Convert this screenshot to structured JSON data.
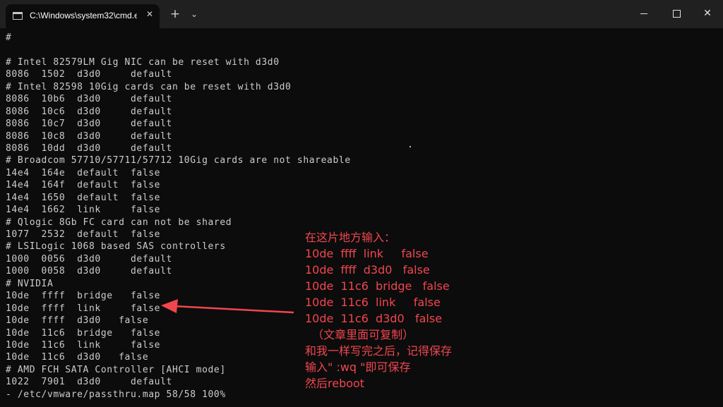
{
  "window": {
    "tab_title": "C:\\Windows\\system32\\cmd.e",
    "tab_close": "✕",
    "new_tab": "+",
    "dropdown": "⌄",
    "close_glyph": "✕"
  },
  "terminal": {
    "lines": [
      "#",
      "",
      "# Intel 82579LM Gig NIC can be reset with d3d0",
      "8086  1502  d3d0     default",
      "# Intel 82598 10Gig cards can be reset with d3d0",
      "8086  10b6  d3d0     default",
      "8086  10c6  d3d0     default",
      "8086  10c7  d3d0     default",
      "8086  10c8  d3d0     default",
      "8086  10dd  d3d0     default",
      "# Broadcom 57710/57711/57712 10Gig cards are not shareable",
      "14e4  164e  default  false",
      "14e4  164f  default  false",
      "14e4  1650  default  false",
      "14e4  1662  link     false",
      "# Qlogic 8Gb FC card can not be shared",
      "1077  2532  default  false",
      "# LSILogic 1068 based SAS controllers",
      "1000  0056  d3d0     default",
      "1000  0058  d3d0     default",
      "# NVIDIA",
      "10de  ffff  bridge   false",
      "10de  ffff  link     false",
      "10de  ffff  d3d0   false",
      "10de  11c6  bridge   false",
      "10de  11c6  link     false",
      "10de  11c6  d3d0   false",
      "# AMD FCH SATA Controller [AHCI mode]",
      "1022  7901  d3d0     default",
      "- /etc/vmware/passthru.map 58/58 100%"
    ]
  },
  "annotation": {
    "lines": [
      "在这片地方输入：",
      "10de  ffff  link     false",
      "10de  ffff  d3d0   false",
      "10de  11c6  bridge   false",
      "10de  11c6  link     false",
      "10de  11c6  d3d0   false",
      "  （文章里面可复制）",
      "和我一样写完之后，记得保存",
      "输入\" :wq \"即可保存",
      "然后reboot"
    ],
    "color": "#f1464f"
  }
}
